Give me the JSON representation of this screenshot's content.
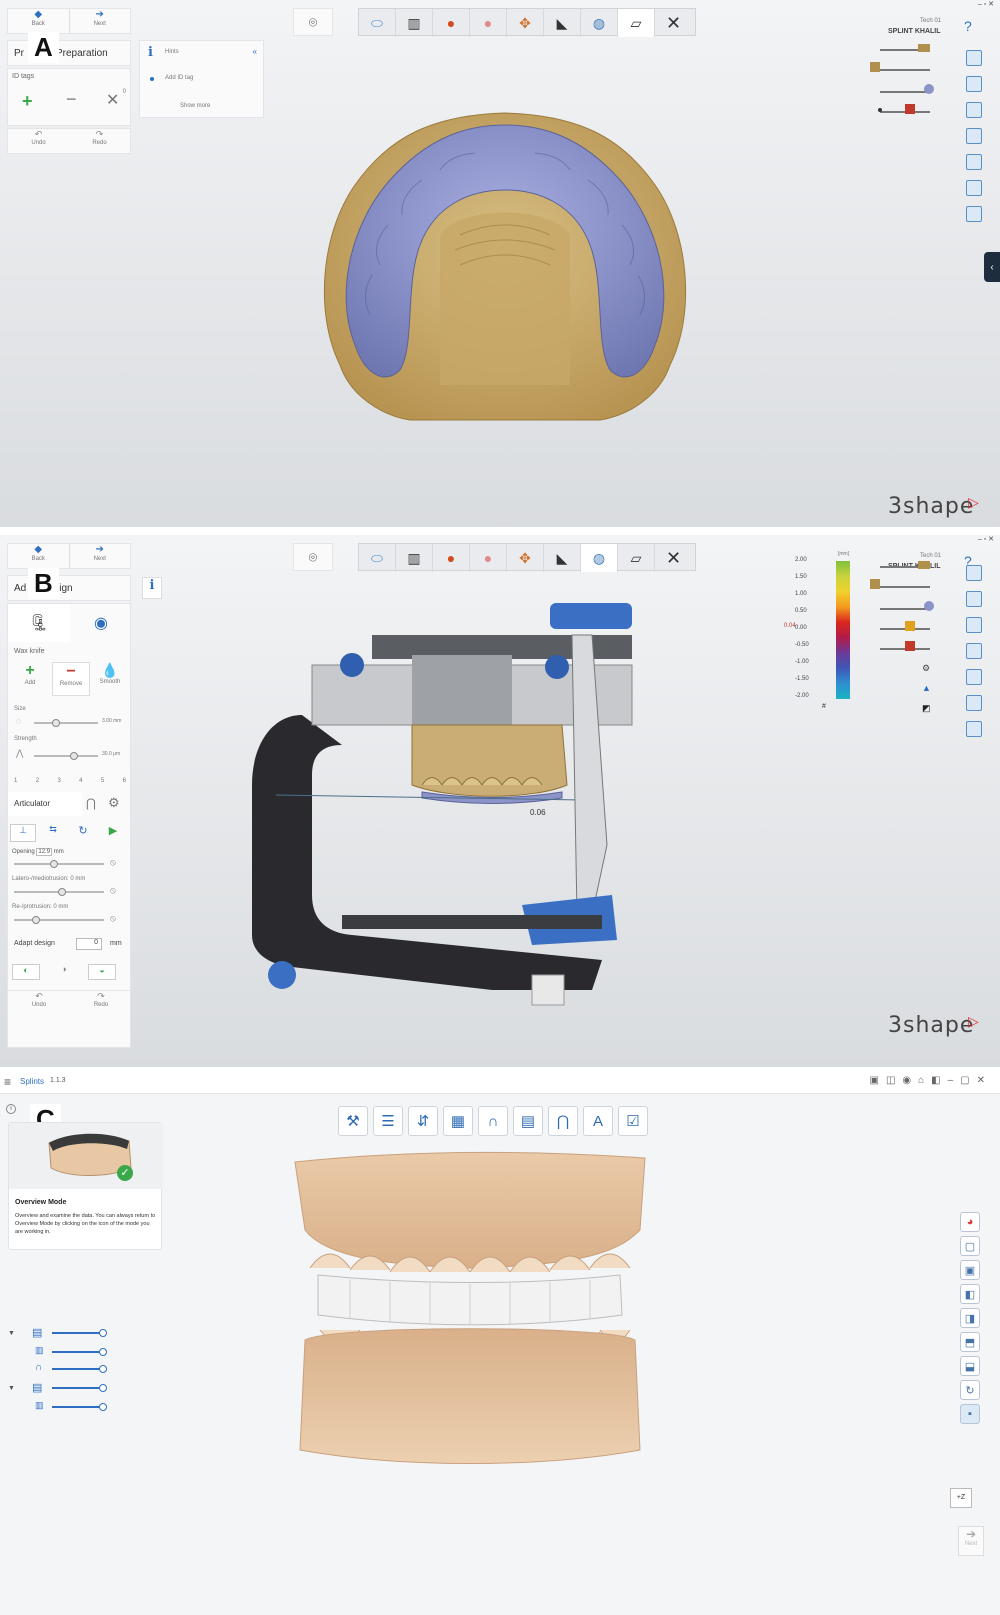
{
  "panel_a": {
    "label": "A",
    "nav": {
      "back": "Back",
      "next": "Next"
    },
    "step_title": "Preparation",
    "step_title_left": "Pr",
    "id_tags": "ID tags",
    "count": "0",
    "undo": "Undo",
    "redo": "Redo",
    "hints": {
      "title": "Hints",
      "item": "Add ID tag",
      "more": "Show more"
    },
    "user": {
      "tech": "Tech 01",
      "name": "SPLINT KHALIL"
    },
    "brand": "3shape"
  },
  "panel_b": {
    "label": "B",
    "nav": {
      "back": "Back",
      "next": "Next"
    },
    "step_title_left": "Ad",
    "step_title_right": "sign",
    "tool_name": "Wax knife",
    "wax_actions": [
      "Add",
      "Remove",
      "Smooth"
    ],
    "size_label": "Size",
    "size_value": "3.00 mm",
    "strength_label": "Strength",
    "strength_value": "30.0 μm",
    "scale": [
      "1",
      "2",
      "3",
      "4",
      "5",
      "6"
    ],
    "articulator": "Articulator",
    "opening_label": "Opening",
    "opening_value": "12.9",
    "opening_unit": "mm",
    "latero": "Latero-/mediotrusion: 0 mm",
    "retro": "Re-/protrusion: 0 mm",
    "adapt_label": "Adapt design",
    "adapt_value": "0",
    "adapt_unit": "mm",
    "undo": "Undo",
    "redo": "Redo",
    "user": {
      "tech": "Tech 01",
      "name": "SPLINT KHALIL"
    },
    "legend_unit": "[mm]",
    "legend_values": [
      "2.00",
      "1.50",
      "1.00",
      "0.50",
      "0.00",
      "-0.50",
      "-1.00",
      "-1.50",
      "-2.00"
    ],
    "legend_marker": "0.04",
    "legend_hash": "#",
    "measure_value": "0.06",
    "brand": "3shape"
  },
  "panel_c": {
    "label": "C",
    "app_name": "Splints",
    "app_version": "1.1.3",
    "overview_title": "Overview Mode",
    "overview_text": "Overview and examine the data. You can always return to Overview Mode by clicking on the icon of the mode you are working in.",
    "zoom_btn": "+Z",
    "next_btn": "Next"
  },
  "colors": {
    "accent_blue": "#2f6fc1",
    "check_green": "#3aa84a",
    "splint_purple": "#8b93c9",
    "model_gold": "#c9ad74",
    "model_peach": "#e8c7a5"
  }
}
